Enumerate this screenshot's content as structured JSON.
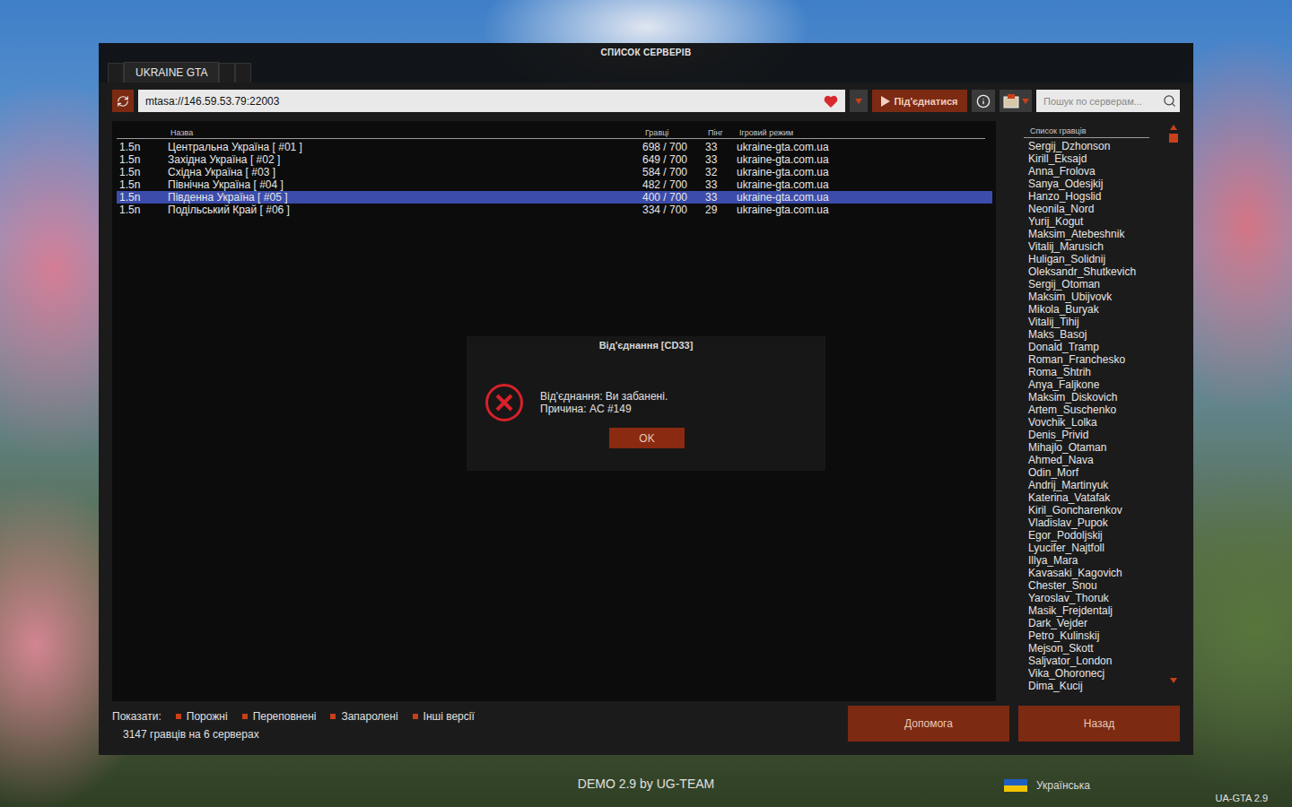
{
  "window": {
    "title": "СПИСОК СЕРВЕРІВ"
  },
  "tabs": [
    {
      "label": "UKRAINE GTA",
      "selected": true
    }
  ],
  "toolbar": {
    "address": "mtasa://146.59.53.79:22003",
    "favorite": true,
    "connect_button": "Під'єднатися",
    "search": {
      "placeholder": "Пошук по серверам..."
    }
  },
  "table": {
    "columns": [
      "Назва",
      "Гравці",
      "Пінг",
      "Ігровий режим"
    ],
    "rows": [
      {
        "version": "1.5n",
        "name": "Центральна Україна [ #01 ]",
        "players": "698 / 700",
        "ping": "33",
        "gamemode": "ukraine-gta.com.ua",
        "selected": false
      },
      {
        "version": "1.5n",
        "name": "Західна Україна [ #02 ]",
        "players": "649 / 700",
        "ping": "33",
        "gamemode": "ukraine-gta.com.ua",
        "selected": false
      },
      {
        "version": "1.5n",
        "name": "Східна Україна [ #03 ]",
        "players": "584 / 700",
        "ping": "32",
        "gamemode": "ukraine-gta.com.ua",
        "selected": false
      },
      {
        "version": "1.5n",
        "name": "Північна Україна [ #04 ]",
        "players": "482 / 700",
        "ping": "33",
        "gamemode": "ukraine-gta.com.ua",
        "selected": false
      },
      {
        "version": "1.5n",
        "name": "Південна Україна [ #05 ]",
        "players": "400 / 700",
        "ping": "33",
        "gamemode": "ukraine-gta.com.ua",
        "selected": true
      },
      {
        "version": "1.5n",
        "name": "Подільський Край [ #06 ]",
        "players": "334 / 700",
        "ping": "29",
        "gamemode": "ukraine-gta.com.ua",
        "selected": false
      }
    ]
  },
  "player_list": {
    "title": "Список гравців",
    "players": [
      "Sergij_Dzhonson",
      "Kirill_Eksajd",
      "Anna_Frolova",
      "Sanya_Odesjkij",
      "Hanzo_Hogslid",
      "Neonila_Nord",
      "Yurij_Kogut",
      "Maksim_Atebeshnik",
      "Vitalij_Marusich",
      "Huligan_Solidnij",
      "Oleksandr_Shutkevich",
      "Sergij_Otoman",
      "Maksim_Ubijvovk",
      "Mikola_Buryak",
      "Vitalij_Tihij",
      "Maks_Basoj",
      "Donald_Tramp",
      "Roman_Franchesko",
      "Roma_Shtrih",
      "Anya_Faljkone",
      "Maksim_Diskovich",
      "Artem_Suschenko",
      "Vovchik_Lolka",
      "Denis_Privid",
      "Mihajlo_Otaman",
      "Ahmed_Nava",
      "Odin_Morf",
      "Andrij_Martinyuk",
      "Katerina_Vatafak",
      "Kiril_Goncharenkov",
      "Vladislav_Pupok",
      "Egor_Podoljskij",
      "Lyucifer_Najtfoll",
      "Illya_Mara",
      "Kavasaki_Kagovich",
      "Chester_Snou",
      "Yaroslav_Thoruk",
      "Masik_Frejdentalj",
      "Dark_Vejder",
      "Petro_Kulinskij",
      "Mejson_Skott",
      "Saljvator_London",
      "Vika_Ohoronecj",
      "Dima_Kucij"
    ]
  },
  "filters": {
    "label": "Показати:",
    "items": [
      {
        "label": "Порожні",
        "checked": true
      },
      {
        "label": "Переповнені",
        "checked": true
      },
      {
        "label": "Запаролені",
        "checked": true
      },
      {
        "label": "Інші версії",
        "checked": true
      }
    ]
  },
  "status_bar": "3147 гравців на 6 серверах",
  "buttons": [
    "Допомога",
    "Назад"
  ],
  "dialog": {
    "title": "Від'єднання [CD33]",
    "lines": [
      "Від'єднання: Ви забанені.",
      "Причина: AC #149"
    ],
    "button": "OK"
  },
  "footer": {
    "credit": "DEMO 2.9 by UG-TEAM",
    "language": "Українська",
    "version": "UA-GTA 2.9"
  }
}
